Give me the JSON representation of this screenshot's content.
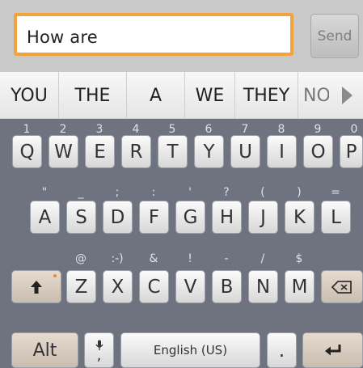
{
  "text_input": {
    "value": "How are"
  },
  "send_label": "Send",
  "suggestions": [
    "YOU",
    "THE",
    "A",
    "WE",
    "THEY",
    "NO"
  ],
  "row1": {
    "hints": [
      "1",
      "2",
      "3",
      "4",
      "5",
      "6",
      "7",
      "8",
      "9",
      "0"
    ],
    "keys": [
      "Q",
      "W",
      "E",
      "R",
      "T",
      "Y",
      "U",
      "I",
      "O",
      "P"
    ]
  },
  "row2": {
    "hints": [
      "\"",
      "_",
      ";",
      ":",
      "'",
      "?",
      "(",
      ")",
      "="
    ],
    "keys": [
      "A",
      "S",
      "D",
      "F",
      "G",
      "H",
      "J",
      "K",
      "L"
    ]
  },
  "row3": {
    "hints": [
      "@",
      ":-)",
      "&",
      "!",
      "-",
      "/",
      "$"
    ],
    "keys": [
      "Z",
      "X",
      "C",
      "V",
      "B",
      "N",
      "M"
    ]
  },
  "row4": {
    "alt_label": "Alt",
    "mic_comma": ",",
    "space_label": "English (US)",
    "period": "."
  },
  "icons": {
    "shift": "shift-arrow-icon",
    "delete": "backspace-icon",
    "enter": "enter-icon",
    "mic": "microphone-icon",
    "suggestions_more": "chevron-right-icon"
  }
}
